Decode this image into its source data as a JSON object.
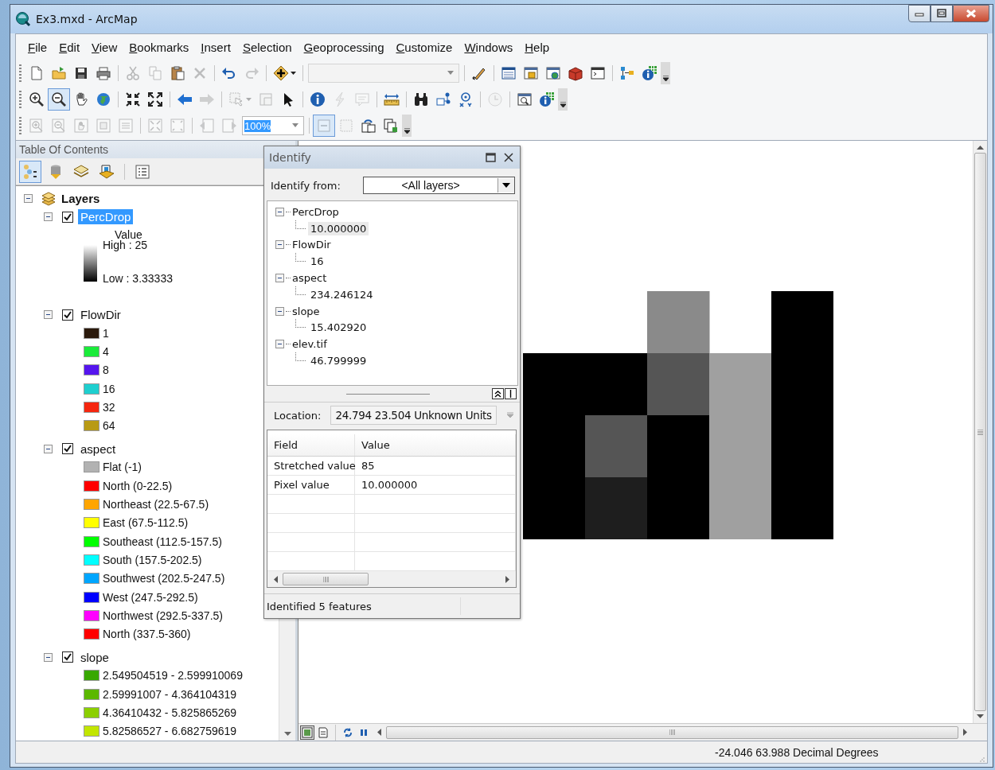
{
  "window": {
    "title": "Ex3.mxd - ArcMap"
  },
  "menu": [
    "File",
    "Edit",
    "View",
    "Bookmarks",
    "Insert",
    "Selection",
    "Geoprocessing",
    "Customize",
    "Windows",
    "Help"
  ],
  "toolbars": [
    {
      "items": [
        {
          "kind": "button",
          "disabled": false,
          "selected": false
        },
        {
          "kind": "button",
          "disabled": false,
          "selected": false
        },
        {
          "kind": "button",
          "disabled": false,
          "selected": false
        },
        {
          "kind": "button",
          "disabled": false,
          "selected": false
        },
        {
          "kind": "separator"
        },
        {
          "kind": "button",
          "disabled": true,
          "selected": false
        },
        {
          "kind": "button",
          "disabled": true,
          "selected": false
        },
        {
          "kind": "button",
          "disabled": false,
          "selected": false
        },
        {
          "kind": "button",
          "disabled": true,
          "selected": false
        },
        {
          "kind": "separator"
        },
        {
          "kind": "button",
          "disabled": false,
          "selected": false
        },
        {
          "kind": "button",
          "disabled": true,
          "selected": false
        },
        {
          "kind": "separator"
        },
        {
          "kind": "menu-button",
          "disabled": false,
          "selected": false
        },
        {
          "kind": "separator"
        },
        {
          "kind": "combo",
          "disabled": true
        },
        {
          "kind": "separator"
        },
        {
          "kind": "button",
          "disabled": false,
          "selected": false
        },
        {
          "kind": "separator"
        },
        {
          "kind": "button",
          "disabled": false,
          "selected": false
        },
        {
          "kind": "button",
          "disabled": false,
          "selected": false
        },
        {
          "kind": "button",
          "disabled": false,
          "selected": false
        },
        {
          "kind": "button",
          "disabled": false,
          "selected": false
        },
        {
          "kind": "button",
          "disabled": false,
          "selected": false
        },
        {
          "kind": "separator"
        },
        {
          "kind": "button",
          "disabled": false,
          "selected": false
        },
        {
          "kind": "button",
          "disabled": false,
          "selected": false
        },
        {
          "kind": "overflow"
        }
      ]
    },
    {
      "items": [
        {
          "kind": "button",
          "disabled": false,
          "selected": false
        },
        {
          "kind": "button",
          "disabled": false,
          "selected": true
        },
        {
          "kind": "button",
          "disabled": false,
          "selected": false
        },
        {
          "kind": "button",
          "disabled": false,
          "selected": false
        },
        {
          "kind": "separator"
        },
        {
          "kind": "button",
          "disabled": false,
          "selected": false
        },
        {
          "kind": "button",
          "disabled": false,
          "selected": false
        },
        {
          "kind": "separator"
        },
        {
          "kind": "button",
          "disabled": false,
          "selected": false
        },
        {
          "kind": "button",
          "disabled": true,
          "selected": false
        },
        {
          "kind": "separator"
        },
        {
          "kind": "menu-button",
          "disabled": true,
          "selected": false
        },
        {
          "kind": "button",
          "disabled": true,
          "selected": false
        },
        {
          "kind": "button",
          "disabled": false,
          "selected": false
        },
        {
          "kind": "separator"
        },
        {
          "kind": "button",
          "disabled": false,
          "selected": false
        },
        {
          "kind": "button",
          "disabled": true,
          "selected": false
        },
        {
          "kind": "button",
          "disabled": true,
          "selected": false
        },
        {
          "kind": "separator"
        },
        {
          "kind": "button",
          "disabled": false,
          "selected": false
        },
        {
          "kind": "separator"
        },
        {
          "kind": "button",
          "disabled": false,
          "selected": false
        },
        {
          "kind": "button",
          "disabled": false,
          "selected": false
        },
        {
          "kind": "button",
          "disabled": false,
          "selected": false
        },
        {
          "kind": "separator"
        },
        {
          "kind": "button",
          "disabled": true,
          "selected": false
        },
        {
          "kind": "separator"
        },
        {
          "kind": "button",
          "disabled": false,
          "selected": false
        },
        {
          "kind": "button",
          "disabled": false,
          "selected": false
        },
        {
          "kind": "overflow"
        }
      ]
    },
    {
      "items": [
        {
          "kind": "button",
          "disabled": true,
          "selected": false
        },
        {
          "kind": "button",
          "disabled": true,
          "selected": false
        },
        {
          "kind": "button",
          "disabled": true,
          "selected": false
        },
        {
          "kind": "button",
          "disabled": true,
          "selected": false
        },
        {
          "kind": "button",
          "disabled": true,
          "selected": false
        },
        {
          "kind": "separator"
        },
        {
          "kind": "button",
          "disabled": true,
          "selected": false
        },
        {
          "kind": "button",
          "disabled": true,
          "selected": false
        },
        {
          "kind": "separator"
        },
        {
          "kind": "button",
          "disabled": true,
          "selected": false
        },
        {
          "kind": "button",
          "disabled": true,
          "selected": false
        },
        {
          "kind": "combo",
          "disabled": false,
          "value": "100%"
        },
        {
          "kind": "separator"
        },
        {
          "kind": "button",
          "disabled": true,
          "selected": true
        },
        {
          "kind": "button",
          "disabled": true,
          "selected": false
        },
        {
          "kind": "button",
          "disabled": false,
          "selected": false
        },
        {
          "kind": "button",
          "disabled": false,
          "selected": false
        },
        {
          "kind": "overflow"
        }
      ]
    }
  ],
  "toc": {
    "title": "Table Of Contents",
    "views": [
      {
        "selected": true
      },
      {
        "selected": false
      },
      {
        "selected": false
      },
      {
        "selected": false
      }
    ],
    "root": {
      "label": "Layers",
      "expanded": true
    },
    "layers": [
      {
        "name": "PercDrop",
        "checked": true,
        "selected": true,
        "expanded": true,
        "legend": {
          "kind": "ramp",
          "heading": "Value",
          "high": "High : 25",
          "low": "Low : 3.33333"
        }
      },
      {
        "name": "FlowDir",
        "checked": true,
        "selected": false,
        "expanded": true,
        "legend": {
          "kind": "classes",
          "classes": [
            {
              "label": "1",
              "color": "#2b1a0c"
            },
            {
              "label": "4",
              "color": "#1aeb3a"
            },
            {
              "label": "8",
              "color": "#5515ee"
            },
            {
              "label": "16",
              "color": "#1ecfcf"
            },
            {
              "label": "32",
              "color": "#f5260f"
            },
            {
              "label": "64",
              "color": "#b89a14"
            }
          ]
        }
      },
      {
        "name": "aspect",
        "checked": true,
        "selected": false,
        "expanded": true,
        "legend": {
          "kind": "classes",
          "classes": [
            {
              "label": "Flat (-1)",
              "color": "#b2b2b2"
            },
            {
              "label": "North (0-22.5)",
              "color": "#ff0000"
            },
            {
              "label": "Northeast (22.5-67.5)",
              "color": "#ffa500"
            },
            {
              "label": "East (67.5-112.5)",
              "color": "#ffff00"
            },
            {
              "label": "Southeast (112.5-157.5)",
              "color": "#00ff00"
            },
            {
              "label": "South (157.5-202.5)",
              "color": "#00ffff"
            },
            {
              "label": "Southwest (202.5-247.5)",
              "color": "#00a6ff"
            },
            {
              "label": "West (247.5-292.5)",
              "color": "#0000ff"
            },
            {
              "label": "Northwest (292.5-337.5)",
              "color": "#ff00ff"
            },
            {
              "label": "North (337.5-360)",
              "color": "#ff0000"
            }
          ]
        }
      },
      {
        "name": "slope",
        "checked": true,
        "selected": false,
        "expanded": true,
        "legend": {
          "kind": "classes",
          "classes": [
            {
              "label": "2.549504519 - 2.599910069",
              "color": "#38a800"
            },
            {
              "label": "2.59991007 - 4.364104319",
              "color": "#5bb800"
            },
            {
              "label": "4.36410432 - 5.825865269",
              "color": "#8bcf00"
            },
            {
              "label": "5.82586527 - 6.682759619",
              "color": "#c2e600"
            }
          ]
        }
      }
    ]
  },
  "identify": {
    "title": "Identify",
    "from_label": "Identify from:",
    "from_value": "<All layers>",
    "results": [
      {
        "layer": "PercDrop",
        "value": "10.000000",
        "selected": true
      },
      {
        "layer": "FlowDir",
        "value": "16",
        "selected": false
      },
      {
        "layer": "aspect",
        "value": "234.246124",
        "selected": false
      },
      {
        "layer": "slope",
        "value": "15.402920",
        "selected": false
      },
      {
        "layer": "elev.tif",
        "value": "46.799999",
        "selected": false
      }
    ],
    "location_label": "Location:",
    "location_value": "24.794  23.504 Unknown Units",
    "table": {
      "columns": [
        "Field",
        "Value"
      ],
      "rows": [
        [
          "Stretched value",
          "85"
        ],
        [
          "Pixel value",
          "10.000000"
        ]
      ]
    },
    "status": "Identified 5 features"
  },
  "status_bar": {
    "coordinates": "-24.046  63.988 Decimal Degrees"
  }
}
